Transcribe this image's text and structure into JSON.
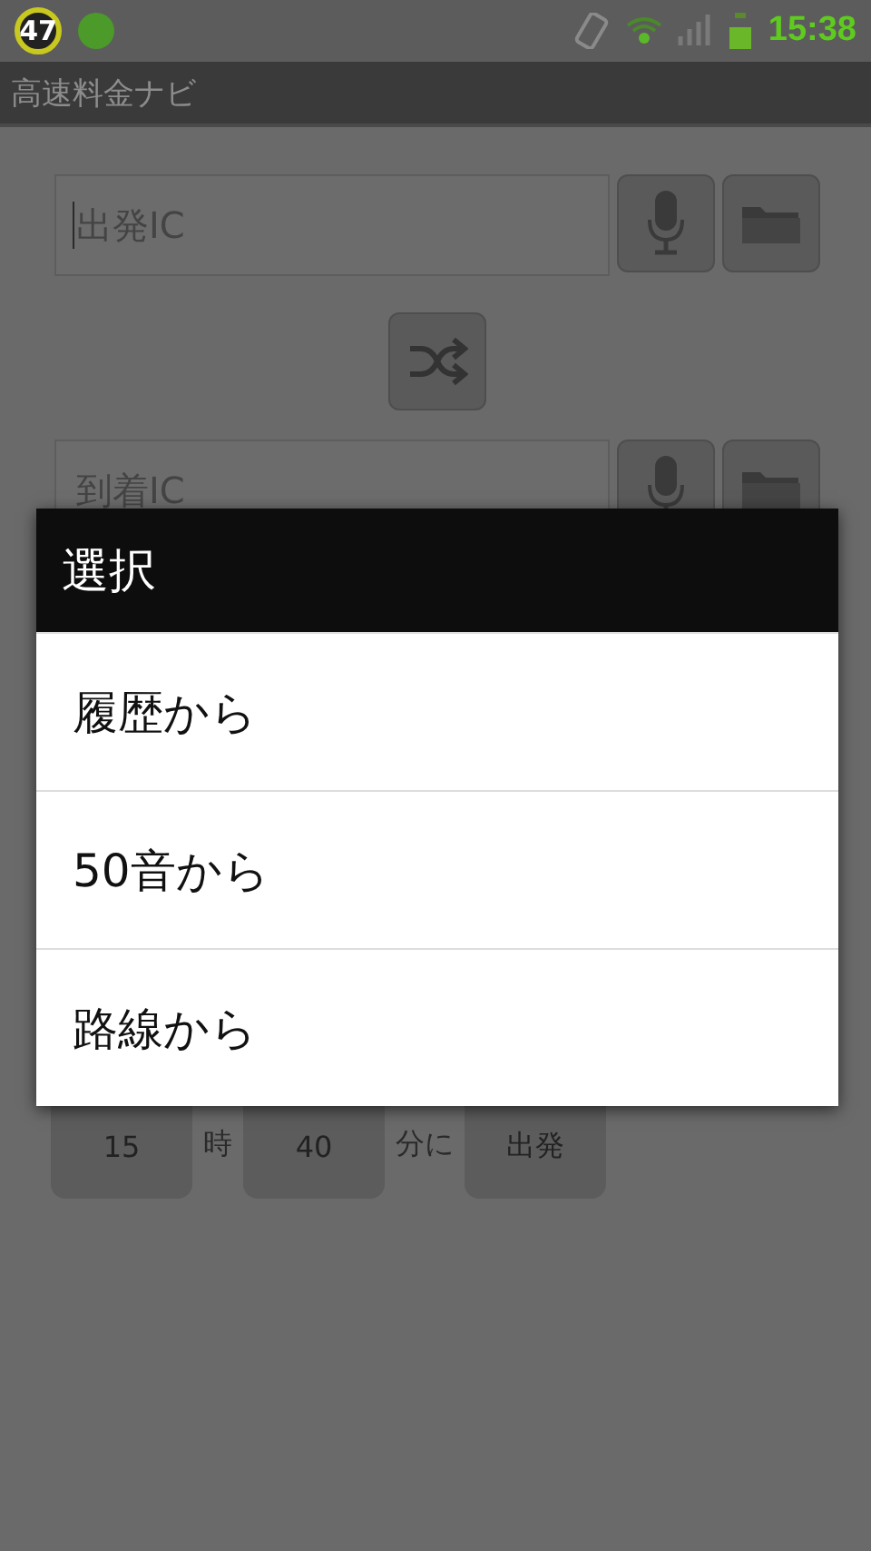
{
  "status_bar": {
    "badge": "47",
    "time": "15:38"
  },
  "title": "高速料金ナビ",
  "departure_field": {
    "placeholder": "出発IC"
  },
  "arrival_field": {
    "placeholder": "到着IC"
  },
  "time_row": {
    "hour": "15",
    "hour_unit": "時",
    "minute": "40",
    "minute_unit": "分に",
    "mode": "出発"
  },
  "dialog": {
    "title": "選択",
    "items": [
      {
        "label": "履歴から"
      },
      {
        "label": "50音から"
      },
      {
        "label": "路線から"
      }
    ]
  }
}
